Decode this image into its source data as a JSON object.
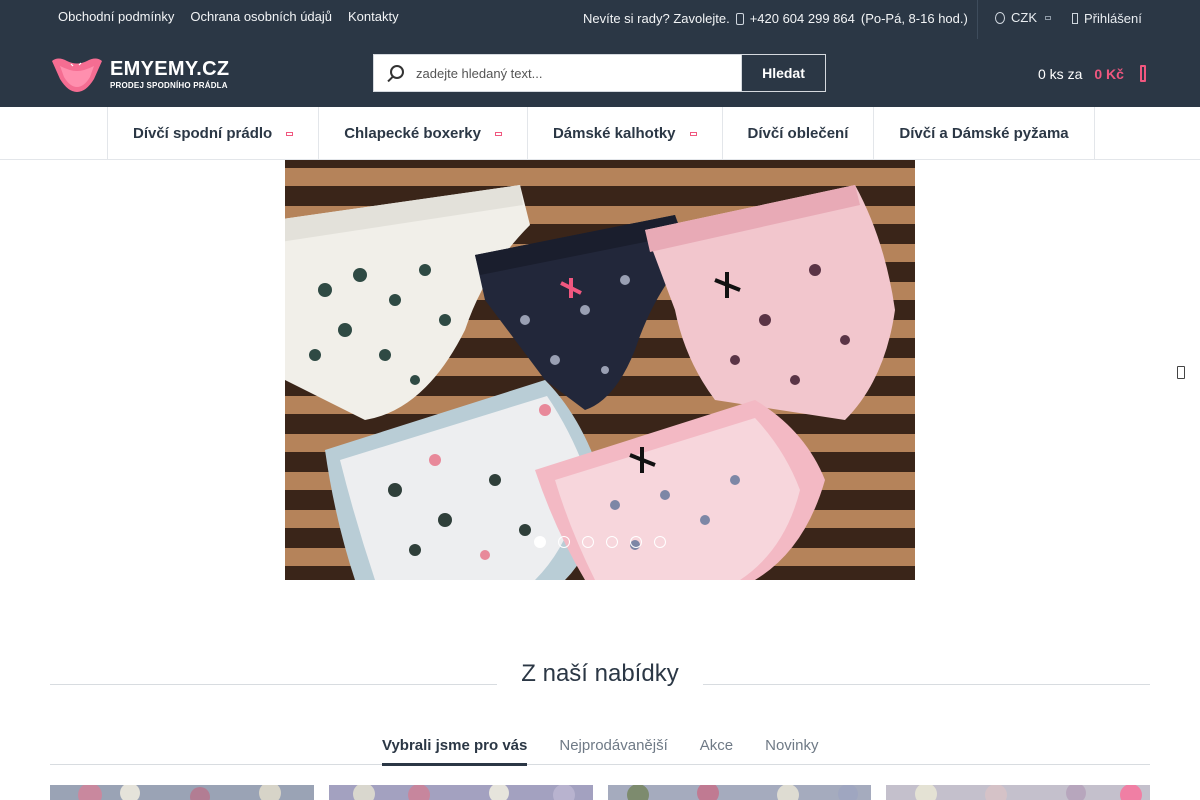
{
  "topbar": {
    "links": [
      "Obchodní podmínky",
      "Ochrana osobních údajů",
      "Kontakty"
    ],
    "contact_text": "Nevíte si rady? Zavolejte.",
    "phone": "+420 604 299 864",
    "hours": "(Po-Pá, 8-16 hod.)",
    "currency": "CZK",
    "login": "Přihlášení"
  },
  "header": {
    "logo_brand": "EMYEMY.CZ",
    "logo_tagline": "PRODEJ SPODNÍHO PRÁDLA",
    "search_placeholder": "zadejte hledaný text...",
    "search_button": "Hledat",
    "cart_count": "0 ks za",
    "cart_sum": "0 Kč"
  },
  "nav": {
    "items": [
      {
        "label": "Dívčí spodní prádlo",
        "has_submenu": true
      },
      {
        "label": "Chlapecké boxerky",
        "has_submenu": true
      },
      {
        "label": "Dámské kalhotky",
        "has_submenu": true
      },
      {
        "label": "Dívčí oblečení",
        "has_submenu": false
      },
      {
        "label": "Dívčí a Dámské pyžama",
        "has_submenu": false
      }
    ]
  },
  "banner": {
    "slide_count": 6,
    "active_slide": 1
  },
  "section": {
    "title": "Z naší nabídky",
    "tabs": [
      "Vybrali jsme pro vás",
      "Nejprodávanější",
      "Akce",
      "Novinky"
    ],
    "active_tab": 0
  },
  "colors": {
    "dark": "#2b3745",
    "accent": "#f0577f"
  }
}
